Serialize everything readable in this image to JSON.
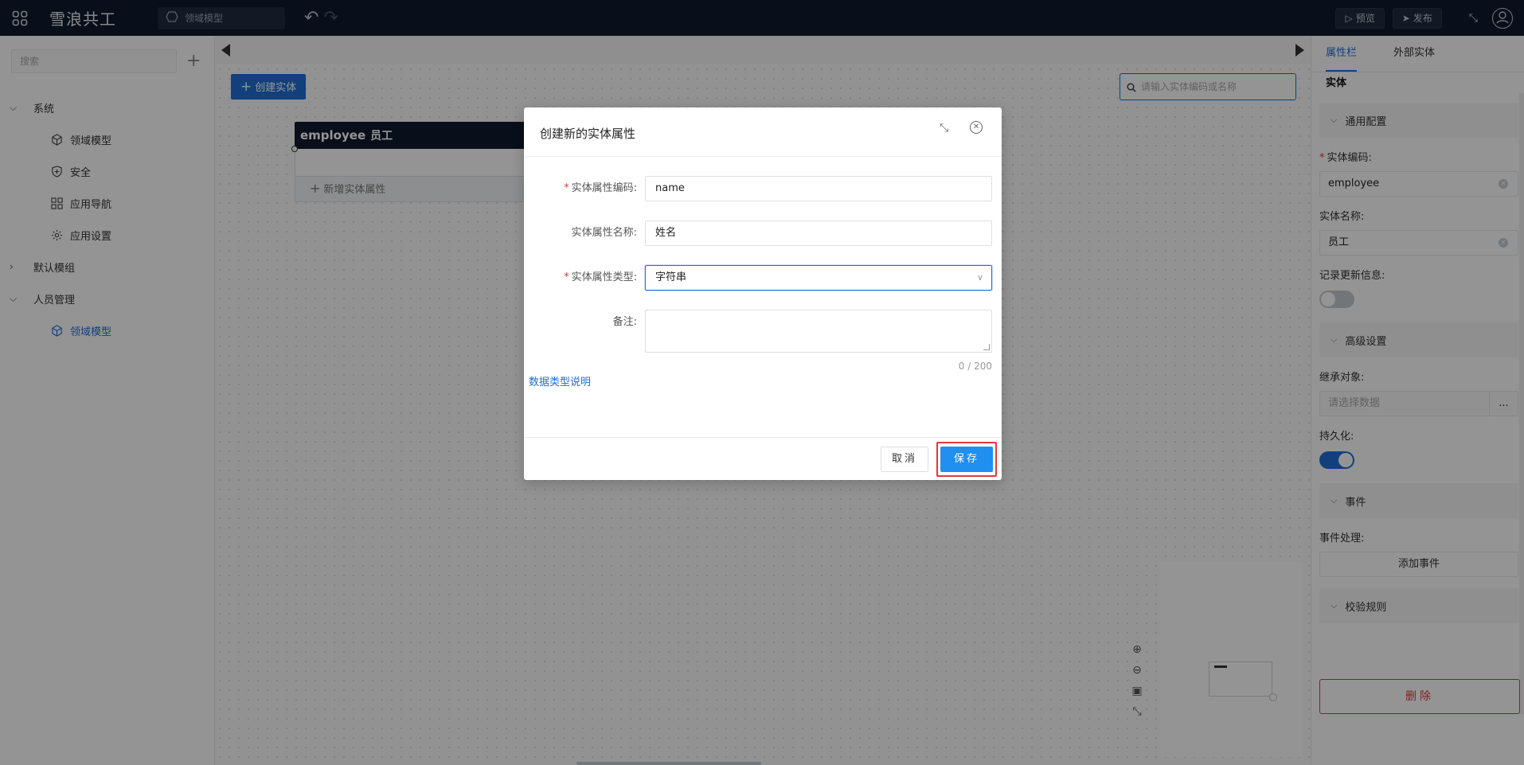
{
  "header": {
    "app_title": "雪浪共工",
    "breadcrumb": "领域模型",
    "preview_label": "预览",
    "publish_label": "发布"
  },
  "sidebar": {
    "search_placeholder": "搜索",
    "groups": [
      {
        "label": "系统",
        "expanded": true,
        "children": [
          {
            "label": "领域模型",
            "icon": "cube-icon"
          },
          {
            "label": "安全",
            "icon": "shield-icon"
          },
          {
            "label": "应用导航",
            "icon": "grid-icon"
          },
          {
            "label": "应用设置",
            "icon": "gear-icon"
          }
        ]
      },
      {
        "label": "默认模组",
        "expanded": false,
        "children": []
      },
      {
        "label": "人员管理",
        "expanded": true,
        "children": [
          {
            "label": "领域模型",
            "icon": "cube-icon",
            "active": true
          }
        ]
      }
    ]
  },
  "canvas": {
    "create_entity_label": "创建实体",
    "search_placeholder": "请输入实体编码或名称",
    "entity": {
      "code": "employee",
      "name": "员工",
      "add_attribute_label": "新增实体属性"
    }
  },
  "right_panel": {
    "tabs": [
      {
        "label": "属性栏",
        "active": true
      },
      {
        "label": "外部实体",
        "active": false
      }
    ],
    "entity_label": "实体",
    "general_section": "通用配置",
    "entity_code_label": "实体编码:",
    "entity_code_value": "employee",
    "entity_name_label": "实体名称:",
    "entity_name_value": "员工",
    "record_update_label": "记录更新信息:",
    "record_update_on": false,
    "advanced_section": "高级设置",
    "inherit_label": "继承对象:",
    "inherit_placeholder": "请选择数据",
    "inherit_more": "...",
    "persist_label": "持久化:",
    "persist_on": true,
    "events_section": "事件",
    "event_handling_label": "事件处理:",
    "add_event_label": "添加事件",
    "validation_section": "校验规则",
    "delete_label": "删除"
  },
  "modal": {
    "title": "创建新的实体属性",
    "fields": {
      "code_label": "实体属性编码:",
      "code_value": "name",
      "name_label": "实体属性名称:",
      "name_value": "姓名",
      "type_label": "实体属性类型:",
      "type_value": "字符串",
      "remark_label": "备注:",
      "remark_counter": "0 / 200"
    },
    "datatype_link": "数据类型说明",
    "cancel_label": "取消",
    "save_label": "保存"
  },
  "colors": {
    "topbar": "#0f1a2e",
    "accent": "#1f6fd6",
    "save_button": "#1f8ff0",
    "danger": "#e0393e"
  }
}
